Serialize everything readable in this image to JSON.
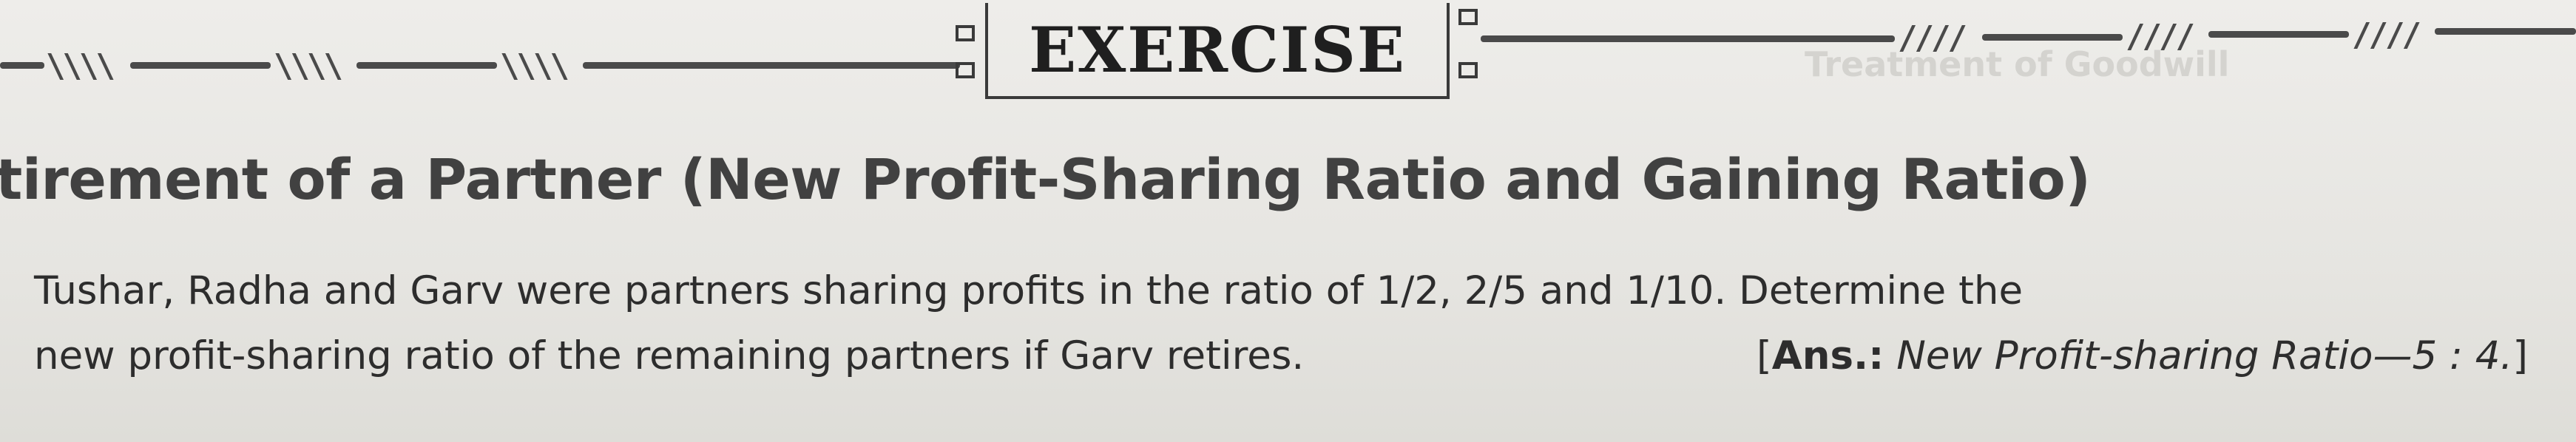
{
  "banner": {
    "title": "EXERCISE"
  },
  "section": {
    "heading": "tirement of a Partner (New Profit-Sharing Ratio and Gaining Ratio)"
  },
  "question": {
    "line1": "Tushar, Radha and Garv were partners sharing profits in the ratio of 1/2, 2/5 and 1/10. Determine the",
    "line2": "new profit-sharing ratio of the remaining partners if Garv retires.",
    "answer": {
      "open_bracket": "[",
      "label": "Ans.:",
      "text": "New Profit-sharing Ratio—5 : 4.",
      "close_bracket": "]"
    }
  },
  "colors": {
    "paper": "#e8e7e3",
    "ink": "#2b2b2b",
    "heading_ink": "#414141"
  }
}
